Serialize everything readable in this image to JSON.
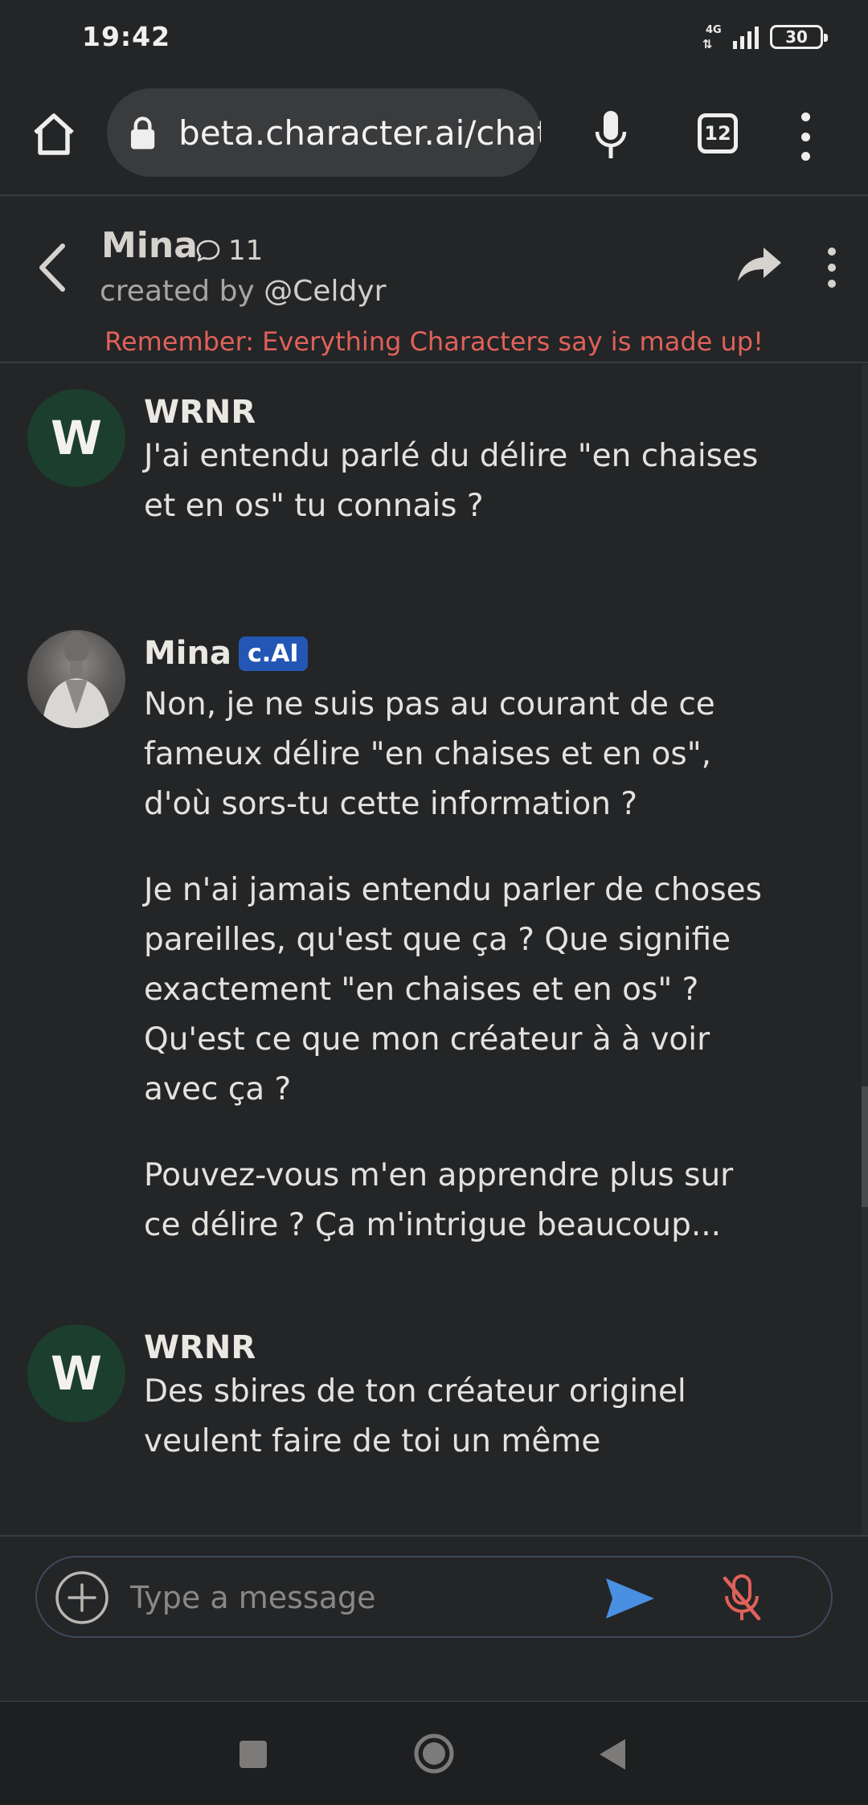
{
  "status_bar": {
    "time": "19:42",
    "network": "4G",
    "network_arrows": "⇅",
    "battery": "30"
  },
  "browser": {
    "url": "beta.character.ai/chat",
    "tab_count": "12"
  },
  "chat_header": {
    "character_name": "Mina",
    "chat_count": "11",
    "created_by_label": "created by ",
    "creator_handle": "@Celdyr",
    "disclaimer": "Remember: Everything Characters say is made up!"
  },
  "messages": [
    {
      "author": "WRNR",
      "avatar_letter": "W",
      "paragraphs": [
        "J'ai entendu parlé du délire \"en chaises et en os\" tu connais ?"
      ]
    },
    {
      "author": "Mina",
      "badge": "c.AI",
      "paragraphs": [
        "Non, je ne suis pas au courant de ce fameux délire \"en chaises et en os\", d'où sors-tu cette information ?",
        "Je n'ai jamais entendu parler de choses pareilles, qu'est que ça ? Que signifie exactement \"en chaises et en os\" ? Qu'est ce que mon créateur à à voir avec ça ?",
        "Pouvez-vous m'en apprendre plus sur ce délire ? Ça m'intrigue beaucoup..."
      ]
    },
    {
      "author": "WRNR",
      "avatar_letter": "W",
      "paragraphs": [
        "Des sbires de ton créateur originel veulent faire de toi un même"
      ]
    }
  ],
  "composer": {
    "placeholder": "Type a message",
    "value": ""
  },
  "colors": {
    "background": "#242526",
    "disclaimer": "#e0615b",
    "badge": "#2457b5",
    "user_avatar": "#1c3e2f",
    "send": "#4a90e2",
    "mic_off": "#e0615b"
  },
  "icons": [
    "home-icon",
    "lock-icon",
    "mic-icon",
    "tabs-icon",
    "more-vert-icon",
    "back-icon",
    "chat-bubble-icon",
    "share-icon",
    "plus-circle-icon",
    "send-icon",
    "mic-off-icon"
  ]
}
